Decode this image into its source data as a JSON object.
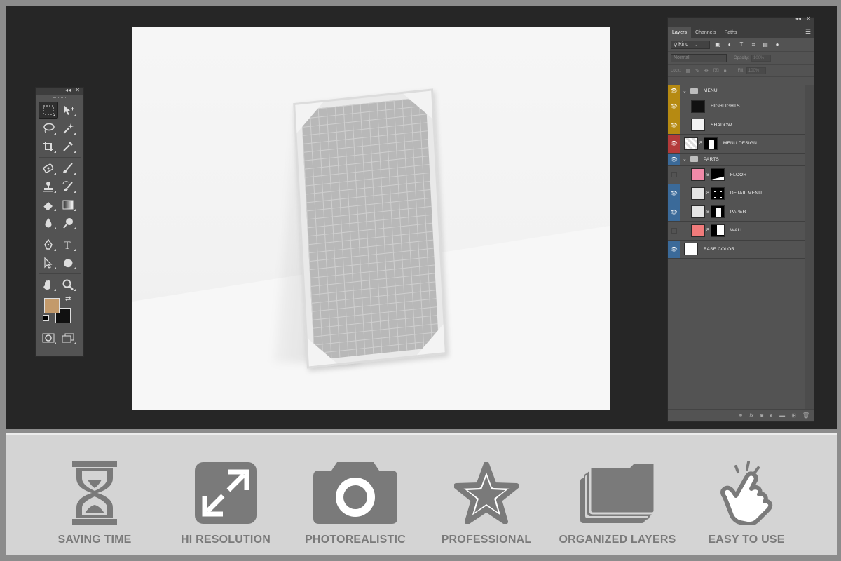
{
  "tools_panel": {
    "collapse": "◂◂",
    "close": "✕",
    "foreground_color": "#c39a6b",
    "background_color": "#111111"
  },
  "layers_panel": {
    "collapse": "◂◂",
    "close": "✕",
    "tabs": [
      {
        "label": "Layers",
        "active": true
      },
      {
        "label": "Channels",
        "active": false
      },
      {
        "label": "Paths",
        "active": false
      }
    ],
    "filter_kind": "Kind",
    "blend_mode": "Normal",
    "opacity_label": "Opacity:",
    "opacity_value": "100%",
    "lock_label": "Lock:",
    "fill_label": "Fill:",
    "fill_value": "100%",
    "layers": [
      {
        "name": "MENU",
        "type": "group",
        "eye_color": "yellow"
      },
      {
        "name": "HIGHLIGHTS",
        "type": "layer",
        "eye_color": "yellow"
      },
      {
        "name": "SHADOW",
        "type": "layer",
        "eye_color": "yellow"
      },
      {
        "name": "MENU DESIGN",
        "type": "smart",
        "eye_color": "red"
      },
      {
        "name": "PARTS",
        "type": "group",
        "eye_color": "blue"
      },
      {
        "name": "FLOOR",
        "type": "fill",
        "eye_color": "none",
        "thumb_color": "#f08aa8"
      },
      {
        "name": "DETAIL MENU",
        "type": "fill",
        "eye_color": "blue",
        "thumb_color": "#e4e4e4"
      },
      {
        "name": "PAPER",
        "type": "fill",
        "eye_color": "blue",
        "thumb_color": "#e4e4e4"
      },
      {
        "name": "WALL",
        "type": "fill",
        "eye_color": "none",
        "thumb_color": "#f07b7b"
      },
      {
        "name": "BASE COLOR",
        "type": "fill",
        "eye_color": "blue",
        "thumb_color": "#ffffff"
      }
    ]
  },
  "features": [
    {
      "label": "SAVING TIME",
      "icon": "hourglass-icon"
    },
    {
      "label": "HI RESOLUTION",
      "icon": "expand-icon"
    },
    {
      "label": "PHOTOREALISTIC",
      "icon": "camera-icon"
    },
    {
      "label": "PROFESSIONAL",
      "icon": "star-icon"
    },
    {
      "label": "ORGANIZED LAYERS",
      "icon": "folders-icon"
    },
    {
      "label": "EASY TO USE",
      "icon": "tap-hand-icon"
    }
  ]
}
